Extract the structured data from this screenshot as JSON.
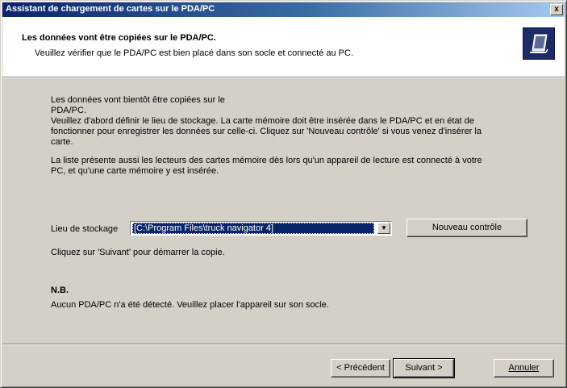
{
  "window": {
    "title": "Assistant de chargement de cartes sur le PDA/PC",
    "close_label": "x"
  },
  "header": {
    "title": "Les données vont être copiées sur le PDA/PC.",
    "subtitle": "Veuillez vérifier que le PDA/PC est bien placé dans son socle et connecté au PC.",
    "icon": "pda-icon"
  },
  "body": {
    "intro_line1": "Les données vont bientôt être copiées sur le",
    "intro_line2": "PDA/PC.",
    "intro_line3": "Veuillez d'abord définir le lieu de stockage. La carte mémoire doit être insérée dans le PDA/PC et en état de",
    "intro_line4": "fonctionner pour enregistrer les données sur celle-ci. Cliquez sur 'Nouveau contrôle' si vous venez d'insérer la",
    "intro_line5": "carte.",
    "list_line1": "La liste présente aussi les lecteurs des cartes mémoire dès lors qu'un appareil de lecture est connecté à votre",
    "list_line2": "PC, et qu'une carte mémoire y est insérée.",
    "storage_label": "Lieu de stockage",
    "storage_value": "[C:\\Program Files\\truck navigator 4]",
    "recheck_button": "Nouveau contrôle",
    "next_hint": "Cliquez sur 'Suivant' pour démarrer la copie.",
    "nb_title": "N.B.",
    "nb_text": "Aucun PDA/PC n'a été détecté. Veuillez placer l'appareil sur son socle."
  },
  "footer": {
    "back_button": "< Précédent",
    "next_button": "Suivant >",
    "cancel_button": "Annuler"
  }
}
